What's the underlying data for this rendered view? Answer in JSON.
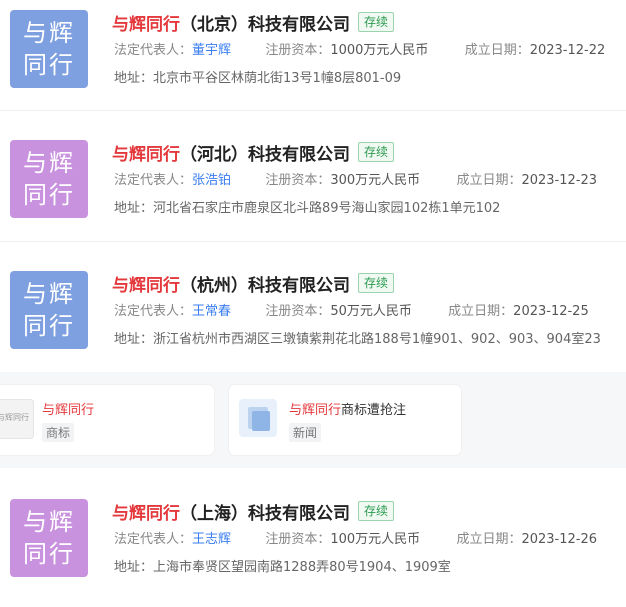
{
  "companies": [
    {
      "logo": [
        "与辉",
        "同行"
      ],
      "logo_color": "#7ea0e0",
      "name_highlight": "与辉同行",
      "name_rest": "（北京）科技有限公司",
      "status": "存续",
      "rep_label": "法定代表人：",
      "rep": "董宇辉",
      "capital_label": "注册资本：",
      "capital": "1000万元人民币",
      "date_label": "成立日期：",
      "date": "2023-12-22",
      "address_label": "地址：",
      "address": "北京市平谷区林荫北街13号1幢8层801-09"
    },
    {
      "logo": [
        "与辉",
        "同行"
      ],
      "logo_color": "#c992df",
      "name_highlight": "与辉同行",
      "name_rest": "（河北）科技有限公司",
      "status": "存续",
      "rep_label": "法定代表人：",
      "rep": "张浩铂",
      "capital_label": "注册资本：",
      "capital": "300万元人民币",
      "date_label": "成立日期：",
      "date": "2023-12-23",
      "address_label": "地址：",
      "address": "河北省石家庄市鹿泉区北斗路89号海山家园102栋1单元102"
    },
    {
      "logo": [
        "与辉",
        "同行"
      ],
      "logo_color": "#7ea0e0",
      "name_highlight": "与辉同行",
      "name_rest": "（杭州）科技有限公司",
      "status": "存续",
      "rep_label": "法定代表人：",
      "rep": "王常春",
      "capital_label": "注册资本：",
      "capital": "50万元人民币",
      "date_label": "成立日期：",
      "date": "2023-12-25",
      "address_label": "地址：",
      "address": "浙江省杭州市西湖区三墩镇紫荆花北路188号1幢901、902、903、904室23"
    },
    {
      "logo": [
        "与辉",
        "同行"
      ],
      "logo_color": "#c992df",
      "name_highlight": "与辉同行",
      "name_rest": "（上海）科技有限公司",
      "status": "存续",
      "rep_label": "法定代表人：",
      "rep": "王志辉",
      "capital_label": "注册资本：",
      "capital": "100万元人民币",
      "date_label": "成立日期：",
      "date": "2023-12-26",
      "address_label": "地址：",
      "address": "上海市奉贤区望园南路1288弄80号1904、1909室"
    }
  ],
  "news": [
    {
      "title_highlight": "与辉同行",
      "title_rest": "",
      "tag": "商标",
      "thumb_text": "与辉同行"
    },
    {
      "title_highlight": "与辉同行",
      "title_rest": "商标遭抢注",
      "tag": "新闻"
    }
  ]
}
